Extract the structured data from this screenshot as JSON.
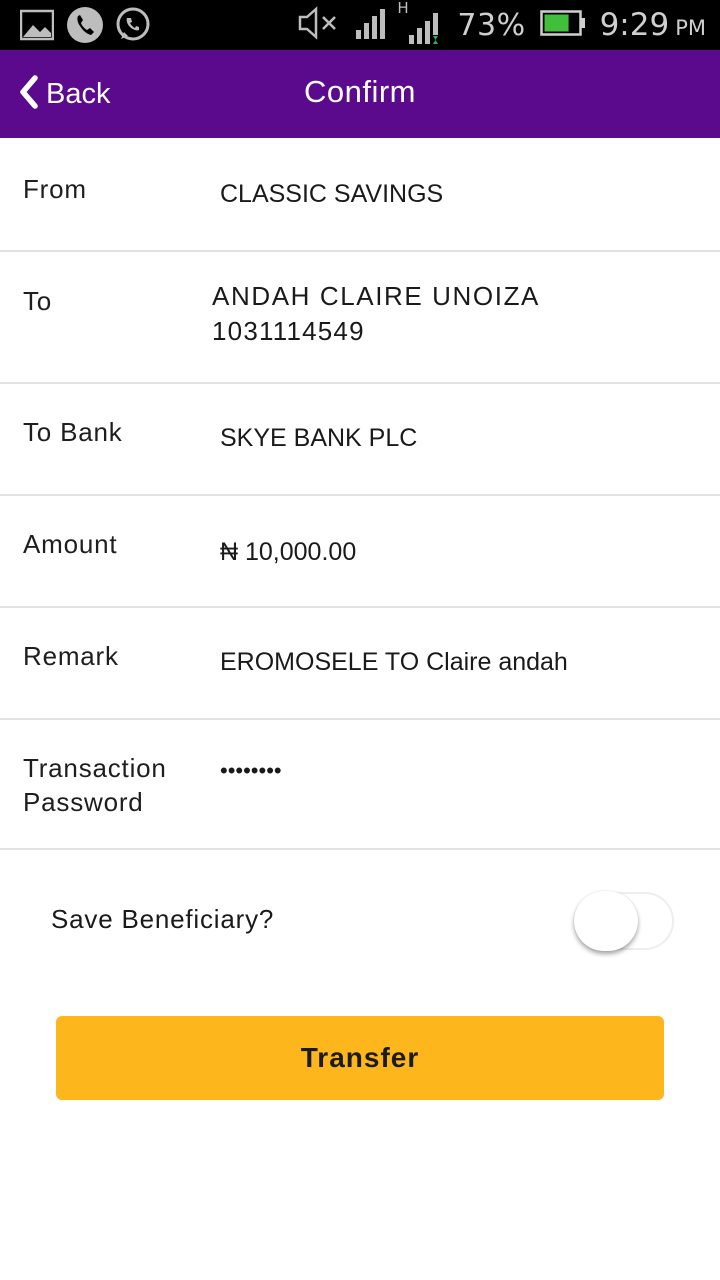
{
  "status_bar": {
    "notification_icons": [
      "image-icon",
      "phone-icon",
      "whatsapp-icon"
    ],
    "signal_label": "H",
    "battery_percent": "73%",
    "battery_level": 0.73,
    "time": "9:29",
    "ampm": "PM"
  },
  "header": {
    "back_label": "Back",
    "title": "Confirm",
    "background": "#5b0a8e"
  },
  "details": {
    "from": {
      "label": "From",
      "value": "CLASSIC SAVINGS"
    },
    "to": {
      "label": "To",
      "name": "ANDAH CLAIRE UNOIZA",
      "account": "1031114549"
    },
    "to_bank": {
      "label": "To Bank",
      "value": "SKYE BANK PLC"
    },
    "amount": {
      "label": "Amount",
      "value": "₦ 10,000.00"
    },
    "remark": {
      "label": "Remark",
      "value": "EROMOSELE TO Claire andah"
    },
    "password": {
      "label_line1": "Transaction",
      "label_line2": "Password",
      "value": "••••••••"
    }
  },
  "save_beneficiary": {
    "label": "Save Beneficiary?",
    "enabled": false
  },
  "transfer_button": {
    "label": "Transfer",
    "color": "#fdb71c"
  }
}
